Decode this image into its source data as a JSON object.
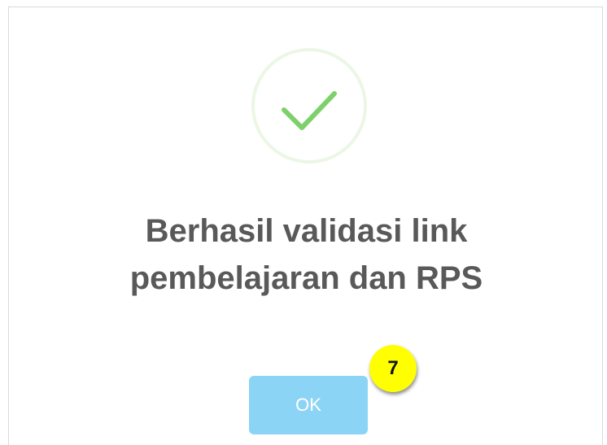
{
  "dialog": {
    "title_line_1": "Berhasil validasi link",
    "title_line_2": "pembelajaran dan RPS",
    "ok_label": "OK",
    "icon": "success-check-icon",
    "colors": {
      "check": "#7ed06a",
      "ring": "#e6f5de",
      "button": "#8cd4f5",
      "title": "#595959"
    }
  },
  "annotation": {
    "step_number": "7",
    "color": "#ffff00"
  }
}
